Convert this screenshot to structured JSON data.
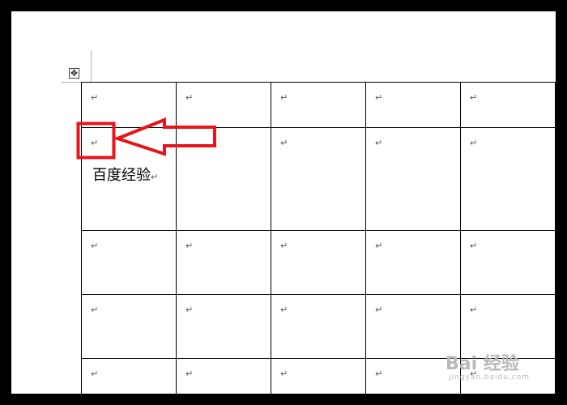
{
  "document": {
    "move_handle_glyph": "✥",
    "paragraph_mark": "↵",
    "table": {
      "rows": [
        [
          "↵",
          "↵",
          "↵",
          "↵",
          "↵"
        ],
        [
          "↵",
          "↵",
          "↵",
          "↵",
          "↵"
        ],
        [
          "↵",
          "↵",
          "↵",
          "↵",
          "↵"
        ],
        [
          "↵",
          "↵",
          "↵",
          "↵",
          "↵"
        ],
        [
          "↵",
          "↵",
          "↵",
          "↵",
          "↵"
        ]
      ],
      "highlighted_cell_text": "百度经验",
      "highlighted_cell_tail": "↵"
    }
  },
  "annotation": {
    "color": "#e8141c",
    "shape": "box-with-left-pointing-arrow"
  },
  "watermark": {
    "brand": "Bai 经验",
    "sub": "jingyan.baidu.com"
  }
}
